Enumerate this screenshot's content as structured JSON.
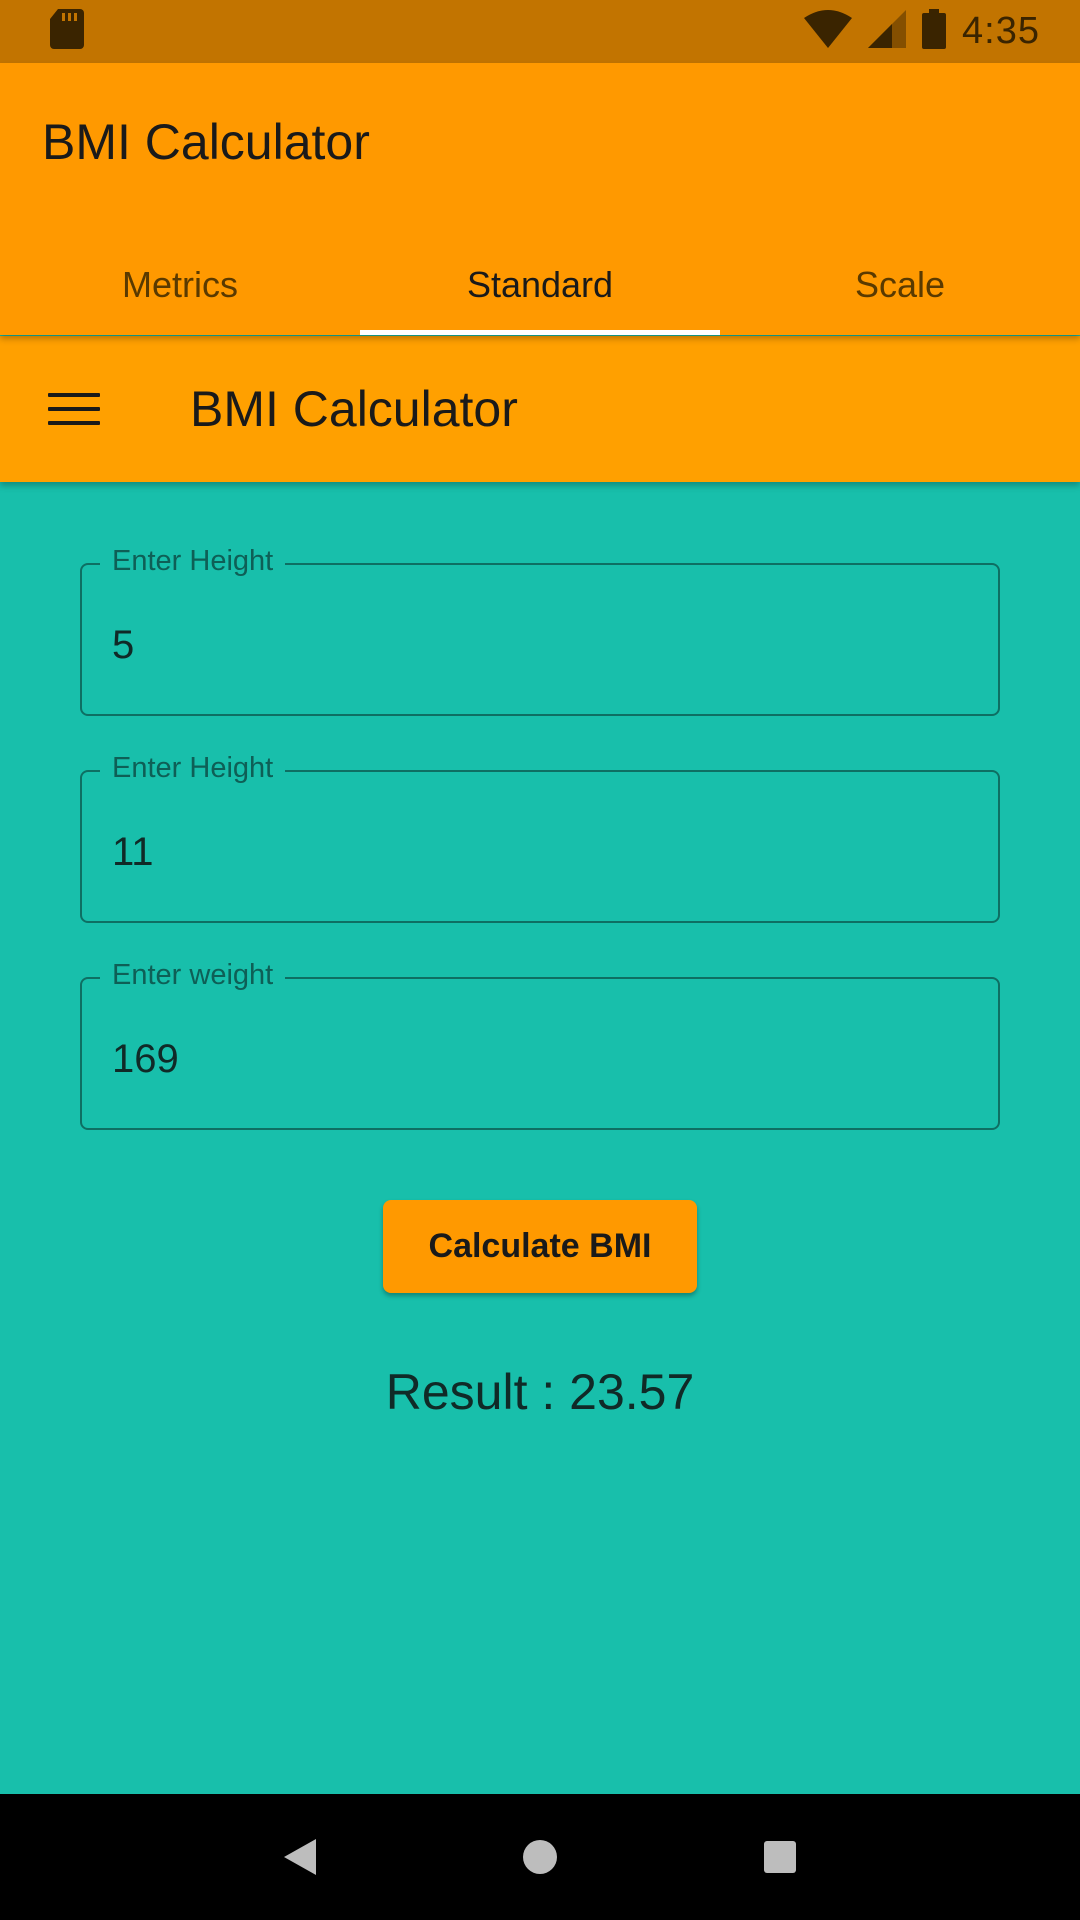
{
  "status_bar": {
    "time": "4:35",
    "icons": [
      "sd-card-icon",
      "wifi-icon",
      "cell-signal-icon",
      "battery-icon"
    ]
  },
  "app_bar": {
    "title": "BMI Calculator",
    "tabs": [
      {
        "label": "Metrics",
        "active": false
      },
      {
        "label": "Standard",
        "active": true
      },
      {
        "label": "Scale",
        "active": false
      }
    ]
  },
  "toolbar": {
    "menu_icon": "hamburger-menu-icon",
    "title": "BMI Calculator"
  },
  "form": {
    "fields": [
      {
        "label": "Enter Height",
        "value": "5"
      },
      {
        "label": "Enter Height",
        "value": "11"
      },
      {
        "label": "Enter weight",
        "value": "169"
      }
    ],
    "button_label": "Calculate BMI",
    "result": "Result : 23.57"
  },
  "colors": {
    "status_bar": "#C27400",
    "app_bar": "#FF9900",
    "background": "#18BFAB",
    "field_border": "#0E6F63"
  },
  "nav_bar": {
    "icons": [
      "back-icon",
      "home-icon",
      "recents-icon"
    ]
  }
}
